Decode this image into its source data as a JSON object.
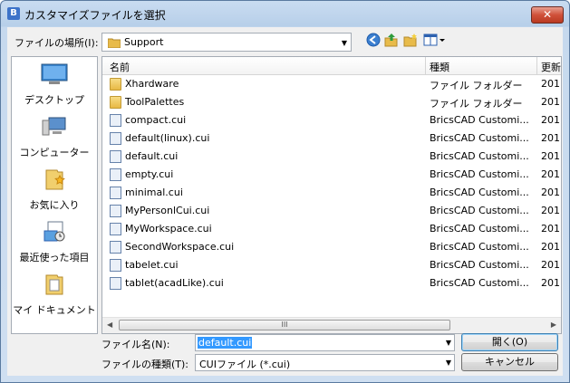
{
  "window": {
    "title": "カスタマイズファイルを選択",
    "close": "✕"
  },
  "lookin": {
    "label": "ファイルの場所(I):",
    "value": "Support"
  },
  "places": [
    {
      "label": "デスクトップ",
      "icon": "desktop-icon"
    },
    {
      "label": "コンピューター",
      "icon": "computer-icon"
    },
    {
      "label": "お気に入り",
      "icon": "favorites-icon"
    },
    {
      "label": "最近使った項目",
      "icon": "recent-items-icon"
    },
    {
      "label": "マイ ドキュメント",
      "icon": "my-documents-icon"
    }
  ],
  "columns": {
    "name": "名前",
    "type": "種類",
    "date": "更新"
  },
  "files": [
    {
      "name": "Xhardware",
      "type": "ファイル フォルダー",
      "date": "201",
      "kind": "folder"
    },
    {
      "name": "ToolPalettes",
      "type": "ファイル フォルダー",
      "date": "201",
      "kind": "folder"
    },
    {
      "name": "compact.cui",
      "type": "BricsCAD Customi...",
      "date": "201",
      "kind": "cui"
    },
    {
      "name": "default(linux).cui",
      "type": "BricsCAD Customi...",
      "date": "201",
      "kind": "cui"
    },
    {
      "name": "default.cui",
      "type": "BricsCAD Customi...",
      "date": "201",
      "kind": "cui"
    },
    {
      "name": "empty.cui",
      "type": "BricsCAD Customi...",
      "date": "201",
      "kind": "cui"
    },
    {
      "name": "minimal.cui",
      "type": "BricsCAD Customi...",
      "date": "201",
      "kind": "cui"
    },
    {
      "name": "MyPersonlCui.cui",
      "type": "BricsCAD Customi...",
      "date": "201",
      "kind": "cui"
    },
    {
      "name": "MyWorkspace.cui",
      "type": "BricsCAD Customi...",
      "date": "201",
      "kind": "cui"
    },
    {
      "name": "SecondWorkspace.cui",
      "type": "BricsCAD Customi...",
      "date": "201",
      "kind": "cui"
    },
    {
      "name": "tabelet.cui",
      "type": "BricsCAD Customi...",
      "date": "201",
      "kind": "cui"
    },
    {
      "name": "tablet(acadLike).cui",
      "type": "BricsCAD Customi...",
      "date": "201",
      "kind": "cui"
    }
  ],
  "filename": {
    "label": "ファイル名(N):",
    "value": "default.cui"
  },
  "filetype": {
    "label": "ファイルの種類(T):",
    "value": "CUIファイル (*.cui)"
  },
  "buttons": {
    "open": "開く(O)",
    "cancel": "キャンセル"
  },
  "scroll": {
    "grip": "III"
  },
  "colors": {
    "selection": "#3399ff",
    "accent": "#3c7fb1"
  }
}
